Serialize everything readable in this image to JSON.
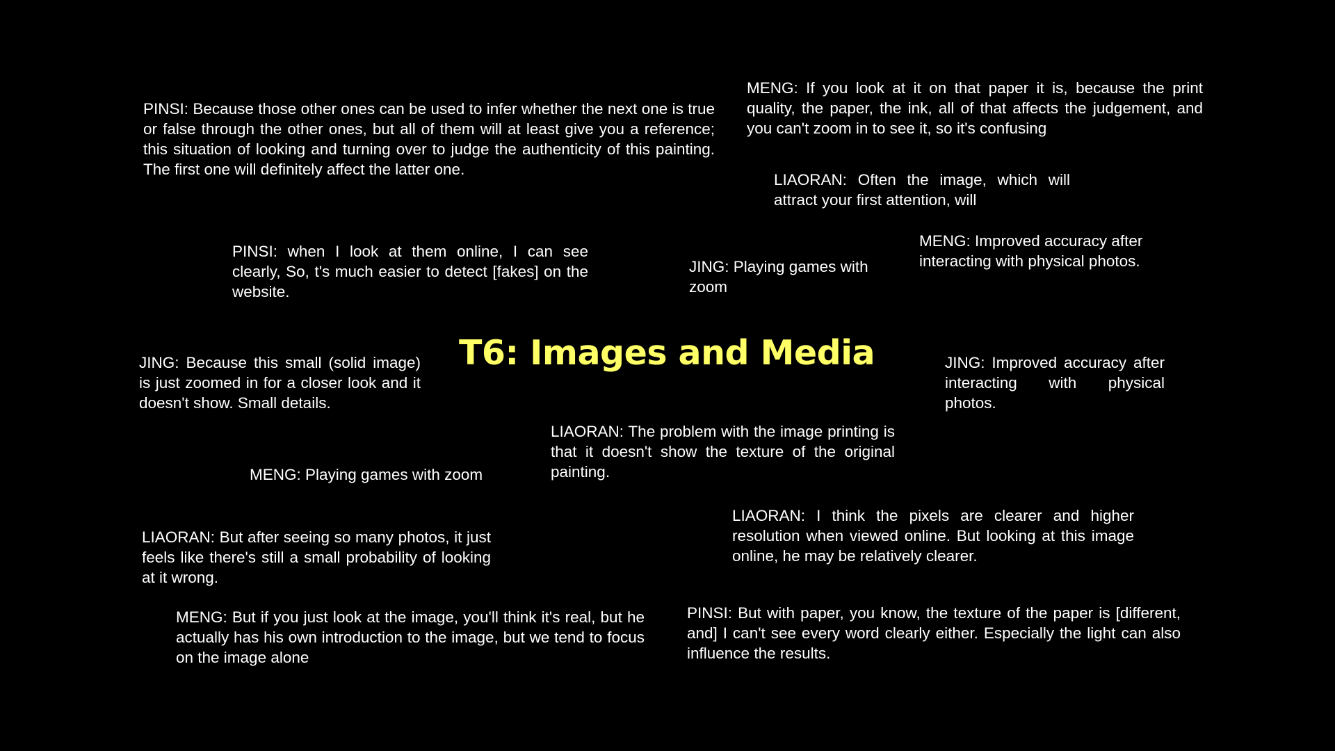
{
  "slide": {
    "title": "T6: Images and Media",
    "title_color": "#ffff66",
    "background_color": "#000000",
    "text_color": "#ffffff",
    "quotes": [
      "PINSI: Because those other ones can be used to infer whether the next one is true or false through the other ones, but all of them will at least give you a reference; this situation of looking and turning over to judge the authenticity of this painting. The first one will definitely affect the latter one.",
      "MENG: If you look at it on that paper it is, because the print quality, the paper, the ink, all of that affects the judgement, and you can't zoom in to see it, so it's confusing",
      "LIAORAN: Often the image, which will attract your first attention, will",
      "PINSI: when I look at them online, I can see clearly, So, t's much easier to detect [fakes] on the website.",
      "JING: Playing games with zoom",
      "MENG: Improved accuracy after interacting with physical photos.",
      "JING: Because this small (solid image) is just zoomed in for a closer look and it doesn't show. Small details.",
      "JING: Improved accuracy after interacting with physical photos.",
      "LIAORAN: The problem with the image printing is that it doesn't show the texture of the original painting.",
      "MENG: Playing games with zoom",
      "LIAORAN: But after seeing so many photos, it just feels like there's still a small probability of looking at it wrong.",
      "LIAORAN: I think the pixels are clearer and higher resolution when viewed online. But looking at this image online, he may be relatively clearer.",
      "MENG: But if you just look at the image, you'll think it's real, but he actually has his own introduction to the image, but we tend to focus on the image alone",
      "PINSI: But with paper, you know, the texture of the paper is [different, and] I can't see every word clearly either. Especially the light can also influence the results."
    ]
  }
}
